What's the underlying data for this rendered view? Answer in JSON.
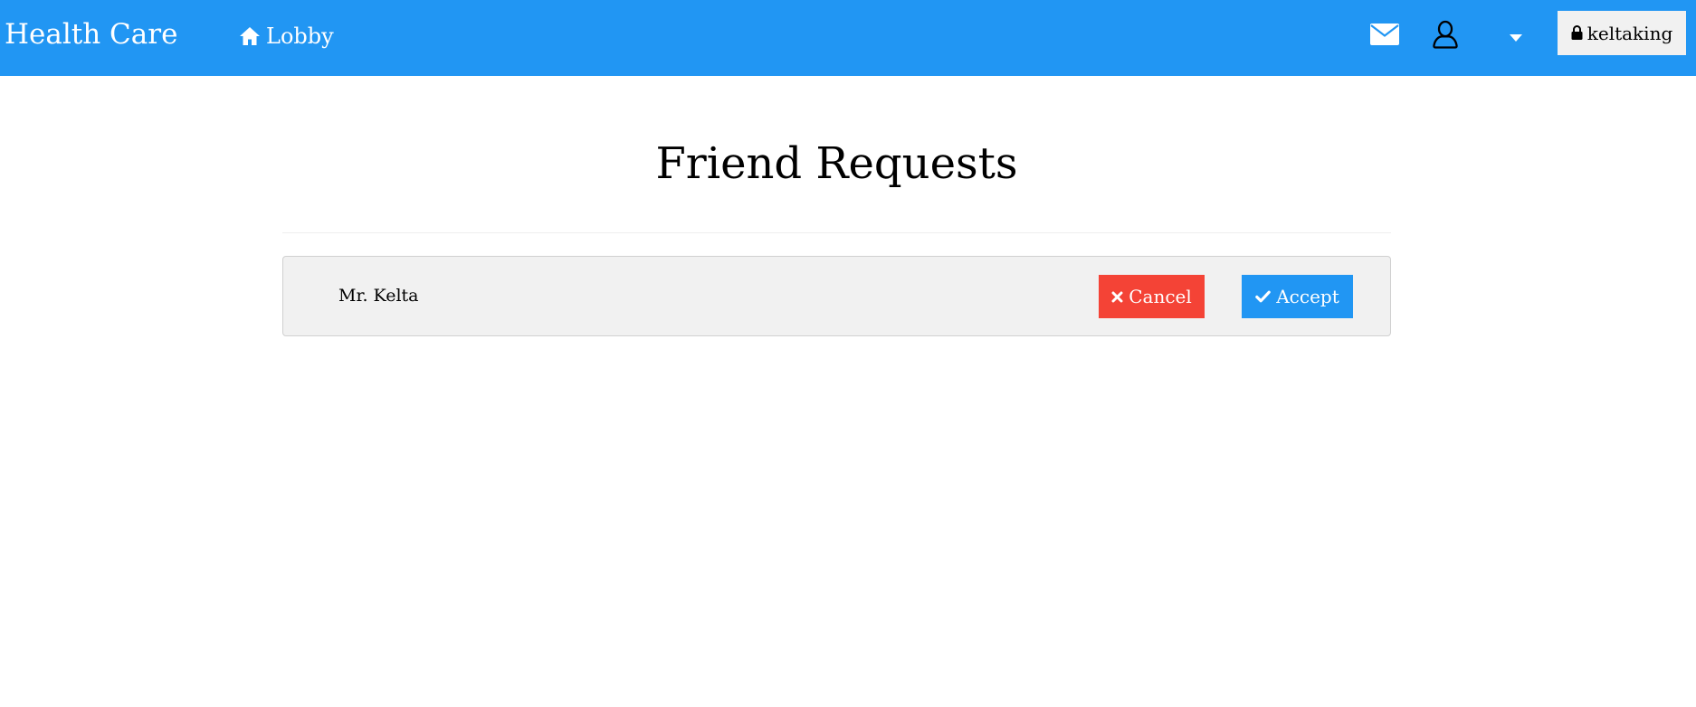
{
  "navbar": {
    "brand": "Health Care",
    "lobby_label": "Lobby",
    "account_label": "keltaking",
    "icons": {
      "lobby": "home-icon",
      "mail": "envelope-icon",
      "user": "user-icon",
      "dropdown": "caret-down-icon",
      "account": "lock-icon"
    },
    "colors": {
      "primary": "#2196f3",
      "account_bg": "#f1f1f1"
    }
  },
  "main": {
    "title": "Friend Requests",
    "requests": [
      {
        "name": "Mr. Kelta",
        "cancel_label": "Cancel",
        "accept_label": "Accept"
      }
    ],
    "colors": {
      "cancel": "#f44336",
      "accept": "#2196f3",
      "card_bg": "#f1f1f1"
    }
  }
}
